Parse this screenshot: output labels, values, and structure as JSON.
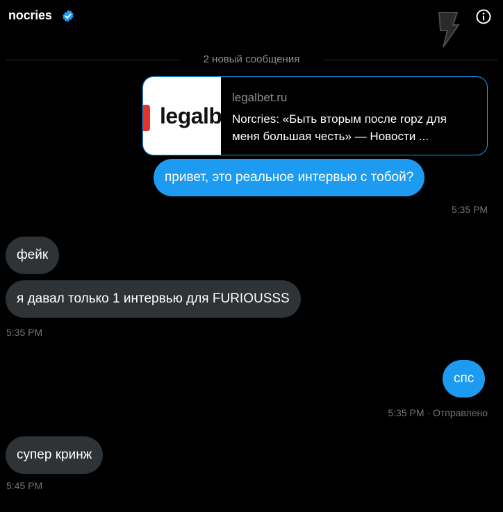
{
  "header": {
    "username": "nocries",
    "verified_icon": "verified-badge-icon",
    "info_icon": "info-icon",
    "logo_icon": "lightning-logo-icon"
  },
  "divider": {
    "label": "2 новый сообщения"
  },
  "link_preview": {
    "thumbnail_text": "legalbe",
    "domain": "legalbet.ru",
    "title": "Norcries: «Быть вторым после ropz для меня большая честь» — Новости ..."
  },
  "messages": [
    {
      "id": "m1",
      "direction": "outgoing",
      "text": "привет, это реальное интервью с тобой?"
    },
    {
      "id": "ts1",
      "direction": "outgoing",
      "timestamp": "5:35 PM"
    },
    {
      "id": "m2",
      "direction": "incoming",
      "text": "фейк"
    },
    {
      "id": "m3",
      "direction": "incoming",
      "text": "я давал только 1 интервью для FURIOUSSS"
    },
    {
      "id": "ts2",
      "direction": "incoming",
      "timestamp": "5:35 PM"
    },
    {
      "id": "m4",
      "direction": "outgoing",
      "text": "спс"
    },
    {
      "id": "ts3",
      "direction": "outgoing",
      "timestamp": "5:35 PM · Отправлено"
    },
    {
      "id": "m5",
      "direction": "incoming",
      "text": "супер кринж"
    },
    {
      "id": "ts4",
      "direction": "incoming",
      "timestamp": "5:45 PM"
    }
  ],
  "colors": {
    "background": "#000000",
    "outgoing_bubble": "#1d9bf0",
    "incoming_bubble": "#2f3336",
    "muted_text": "#8e8e8e",
    "timestamp_text": "#6e767d"
  }
}
